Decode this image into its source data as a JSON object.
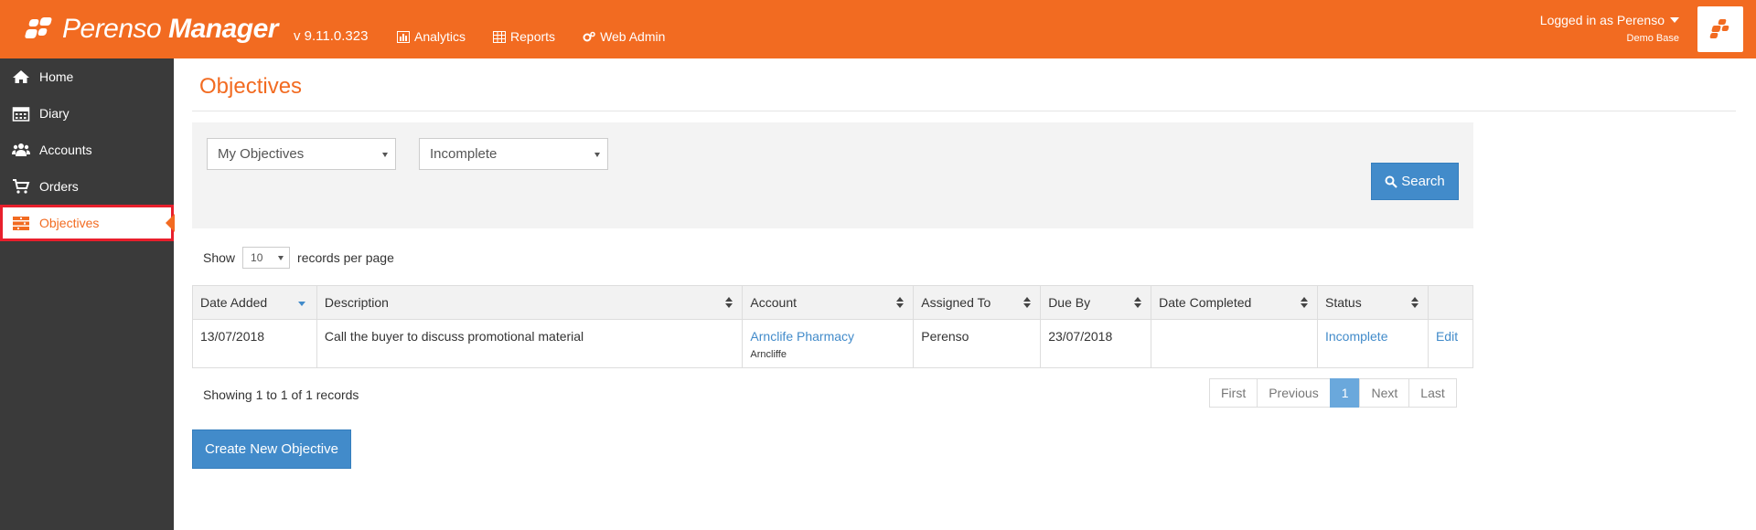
{
  "header": {
    "brand_regular": "Perenso",
    "brand_bold": "Manager",
    "version": "v 9.11.0.323",
    "nav": [
      {
        "label": "Analytics",
        "icon": "chart-icon"
      },
      {
        "label": "Reports",
        "icon": "table-icon"
      },
      {
        "label": "Web Admin",
        "icon": "gears-icon"
      }
    ],
    "user": {
      "logged_in": "Logged in as Perenso",
      "database": "Demo Base"
    }
  },
  "sidebar": {
    "items": [
      {
        "label": "Home",
        "icon": "home-icon"
      },
      {
        "label": "Diary",
        "icon": "calendar-icon"
      },
      {
        "label": "Accounts",
        "icon": "users-icon"
      },
      {
        "label": "Orders",
        "icon": "cart-icon"
      },
      {
        "label": "Objectives",
        "icon": "objectives-icon",
        "active": true
      }
    ]
  },
  "page": {
    "title": "Objectives",
    "filters": {
      "owner": "My Objectives",
      "status": "Incomplete"
    },
    "search_label": "Search",
    "show_prefix": "Show",
    "page_size": "10",
    "show_suffix": "records per page",
    "table": {
      "columns": [
        "Date Added",
        "Description",
        "Account",
        "Assigned To",
        "Due By",
        "Date Completed",
        "Status",
        ""
      ],
      "rows": [
        {
          "date_added": "13/07/2018",
          "description": "Call the buyer to discuss promotional material",
          "account": "Arnclife Pharmacy",
          "account_location": "Arncliffe",
          "assigned_to": "Perenso",
          "due_by": "23/07/2018",
          "date_completed": "",
          "status": "Incomplete",
          "action": "Edit"
        }
      ]
    },
    "showing": "Showing 1 to 1 of 1 records",
    "pager": {
      "first": "First",
      "previous": "Previous",
      "current": "1",
      "next": "Next",
      "last": "Last"
    },
    "create_label": "Create New Objective"
  },
  "colors": {
    "brand": "#f26b21",
    "sidebar": "#3a3a3a",
    "primary": "#428bca",
    "highlight": "#e81f2c"
  }
}
